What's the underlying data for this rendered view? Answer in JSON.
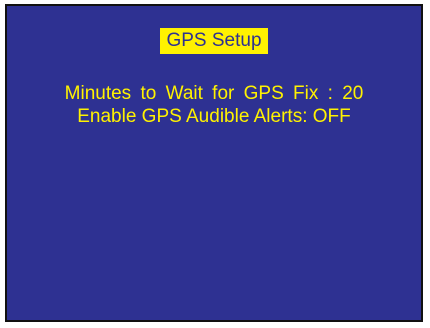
{
  "screen": {
    "title": "GPS Setup",
    "settings": [
      {
        "label": "Minutes to Wait for GPS Fix",
        "separator": " : ",
        "value": "20"
      },
      {
        "label": "Enable GPS Audible Alerts",
        "separator": ": ",
        "value": "OFF"
      }
    ]
  },
  "colors": {
    "background": "#2e3192",
    "text": "#fff200",
    "title_background": "#fff200",
    "title_text": "#2e3192"
  }
}
